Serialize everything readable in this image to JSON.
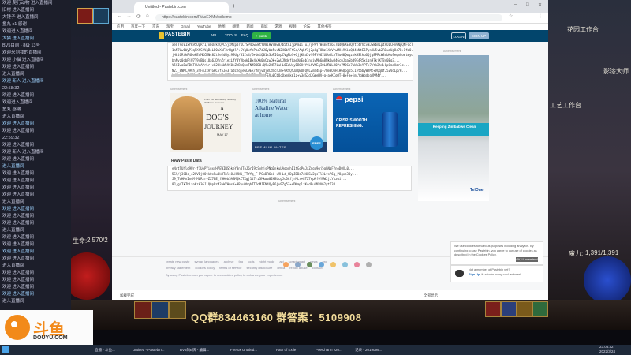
{
  "chat": {
    "messages": [
      "欢迎 爬行动物 进入直播间",
      "旧村 进入直播间",
      "大锤子 进入直播间",
      "鱼丸 x1 感谢",
      "欢迎进入直播间",
      "大猫 进入直播间",
      "BV5目前 - 8级 13号",
      "欢迎来到我的直播间",
      "欢迎 小猫 进入直播间",
      "欢迎 进入直播间",
      "进入直播间",
      "欢迎 新人 进入直播间",
      "22:58:32",
      "欢迎 进入直播间",
      "欢迎进入直播间",
      "鱼丸 感谢",
      "进入直播间",
      "欢迎 进入直播间",
      "欢迎 进入直播间",
      "22:59:32",
      "欢迎 进入直播间",
      "欢迎 新人 进入直播间",
      "欢迎 进入直播间",
      "进入直播间",
      "欢迎 进入直播间",
      "欢迎 进入直播间",
      "欢迎 进入直播间",
      "欢迎 进入直播间",
      "进入直播间",
      "欢迎 进入直播间",
      "欢迎 进入直播间",
      "欢迎 进入直播间",
      "进入直播间",
      "欢迎 进入直播间",
      "欢迎 进入直播间",
      "欢迎 进入直播间",
      "欢迎 进入直播间",
      "进入直播间",
      "欢迎 进入直播间",
      "欢迎 进入直播间",
      "欢迎 进入直播间",
      "欢迎 进入直播间",
      "进入直播间"
    ]
  },
  "game": {
    "life_label": "生命:",
    "life_value": "2,570/2",
    "mana_label": "魔力:",
    "mana_value": "1,391/1,391",
    "right_top": "花园工作台",
    "right_mid1": "影漆大师",
    "right_mid2": "工艺工作台"
  },
  "browser": {
    "tabs": [
      "Untitled - Pastebin.com",
      "Path of Exile"
    ],
    "url": "https://pastebin.com/FtAsEXMx/pdkxmb",
    "bookmarks": [
      "应用",
      "百度一下",
      "京东",
      "淘宝",
      "Gmail",
      "YouTube",
      "地图",
      "翻译",
      "新闻",
      "商城",
      "游戏",
      "视频",
      "论坛",
      "其他书签"
    ]
  },
  "site": {
    "logo": "PASTEBIN",
    "nav": [
      "API",
      "TOOLS",
      "FAQ"
    ],
    "paste_label": "+ paste",
    "login": "LOGIN",
    "signup": "SIGN UP",
    "advert": "Advertisement",
    "raw_title": "RAW Paste Data",
    "code_top": [
      "xeUT9oV1xYK95UpRY1/obUrkzQPCSjxM2pOr1CrSP4pwEWtYV8iHVr8w8/b5tAIjpMmIiTu1/yPAY7W4mdtK6i7N4Q6XEBQVtt4rhcvNJSWbmLptAOICHn9NpQNFQcTwYoCUSUuf...",
      "1aM7Uw6WyP3qPXhS2VgBeLD0aXkF3rHgtlP+GYqUxfoPmc7dJ6yWz5vuN2H0bYFtSe/AqLf3jZpCgT8Rz1XcVrwMHs9KiaQd4oNtE6PynKL5vb2RIuaUg8c7B+Ifm0...",
      "jH0iQRtkP4DoKEqMKCMN48ZtJe2dWyz99Ug/81Is4/G+UmiQ01s3bRI6xpCVgRbS+GjjKkd5vY9PY96IUWoVLnT8uG0QwqzxkHSlkuOQjq8PRcW3qbHu9eqnhomtmydUl8xH...",
      "bnMyz0obPjU7T9vBNs1Oa6JDYnZr1exLfY3YVbqk1Bx4xXk0nCzwOk+2wLJNdefUaeXmEpb1nuiwMb6n8NkOwD4GcwJqaSbd9E4R5xign97kjKT3s0Eq3...",
      "V5kIwaBaFB6TkUoAPrLr+vL20k1WbVC0kZzBsQnnTNfDOD0+Q9x2NR7LuHL6EzUcyEBOHvYtLhVKEqI0LWR1LH0Ps7MDGo7aWk3sYPTx7eYk2h4+QpGmsXzr3c...",
      "N2J_8NMC/9Ch_3YFmJxAtGHC5f5Jo37adczqjewC9Ek/fmjvdj8CdScnJm+9XSQfZmQBUFQ9LZmS4Ep+7Ne3OnH1HGQpgo5C1ytbbyWYMt+VQqOfJ5ZVqLp/H...",
      "bWJbh_+sP47MvdTvzUQKCSPkxKCeVSTo3qzz2LqIHd76Lp7WtFEVu0CbOcQxmAkm1z+y3dS2dJGmeHV+q+a+KCqOT+0+Fm+jmLYgWgdsgXMM4Y..."
    ],
    "code_raw": [
      "eNrtTUhld9Ur-f1UoPYiuxrH7EWINS5keY3nOTnJ6rI9cSvhjsPNqDnkuLAgodhD1tGcPnJxZngc9qj5qhNgFYnoD0XL0...",
      "5S9/j3GDc_e2HVBj0OtkOeRu4kHTmliOLHRN1_TTYfq_F-PGxDR6si-u9HLd_CDpJDDo7d4XSw2gsTl3LvsP6q_P8gxe33y...",
      "J9_ToHMnIn4M-MbRzr+ZZ7BE_fHHeb5ABMQkCTXgj1i7rz3Mkww02HBUcgJcDAfjrMLr+8TZ7epMf9YUW2jLYkzwi...",
      "8J_g4Tk7hLxoKzH3GJ1Q0pPrM3aW7HmsK+9RyuDhqbTTOdMJFN4QyB6jv9Zg5Z+eDMmplzK4dFuUM3VG2ytT3O..."
    ],
    "ads": {
      "dog_small": "From the best-selling novel by W. Bruce Cameron",
      "dog_a": "A",
      "dog_title": "DOG'S",
      "dog_title2": "JOURNEY",
      "dog_date": "MAY 17",
      "water_text": "100% Natural",
      "water_text2": "Alkaline Water",
      "water_text3": "at home",
      "water_brand": "PREMIUM WATER",
      "water_free": "FREE",
      "pepsi_brand": "pepsi",
      "pepsi_slogan": "CRISP. SMOOTH.",
      "pepsi_slogan2": "REFRESHING.",
      "zim_banner": "Keeping Zimbabwe Clean",
      "zim_brand": "TelOne"
    },
    "footer_links": [
      "create new paste",
      "syntax languages",
      "archive",
      "faq",
      "tools",
      "night mode",
      "api",
      "scraping api",
      "news",
      "pro"
    ],
    "footer_links2": [
      "privacy statement",
      "cookies policy",
      "terms of service",
      "security disclosure",
      "dmca",
      "report abuse",
      "contact"
    ],
    "footer_note": "By using Pastebin.com you agree to our cookies policy to enhance your experience.",
    "cookie_text": "We use cookies for various purposes including analytics. By continuing to use Pastebin, you agree to our use of cookies as described in the Cookies Policy.",
    "ok_label": "OK, I Understand",
    "member_text": "Not a member of Pastebin yet?",
    "member_link": "Sign Up",
    "member_text2": ", it unlocks many cool features!"
  },
  "download_shelf": {
    "item": "加载完成",
    "show_all": "全部显示"
  },
  "qq_line": "QQ群834463160  群答案：5109908",
  "douyu": {
    "name": "斗鱼",
    "sub": "DOUYU.COM"
  },
  "taskbar": {
    "items": [
      "直播 - 斗鱼...",
      "Untitled - Pastebin...",
      "BV5的E牌 - 编辑...",
      "Firefox Untitled...",
      "Path of Exile",
      "PoeCharm v20...",
      "记录 - 2019099..."
    ],
    "time": "23:05:32",
    "date": "2022/3/24"
  }
}
